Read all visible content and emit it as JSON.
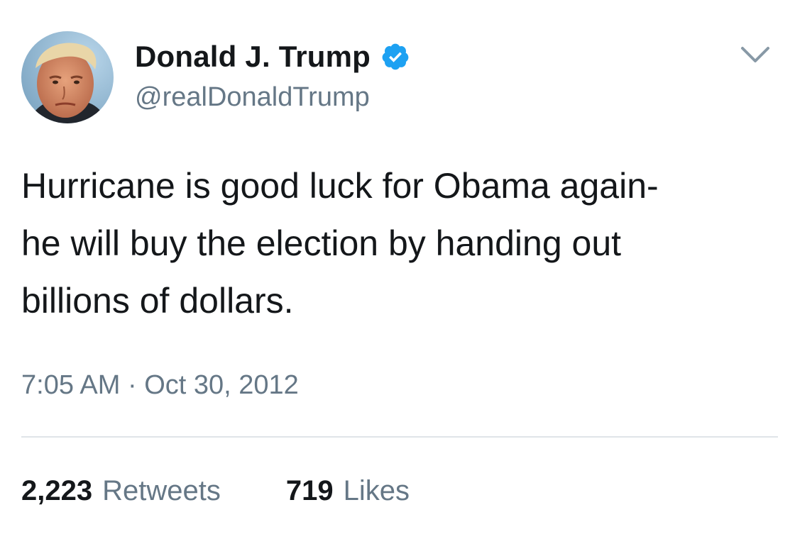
{
  "tweet": {
    "author": {
      "display_name": "Donald J. Trump",
      "handle": "@realDonaldTrump",
      "verified_icon": "verified-badge-icon",
      "avatar_icon": "profile-avatar"
    },
    "text": "Hurricane is good luck for Obama again-\nhe will buy the election by handing out\nbillions of dollars.",
    "timestamp": "7:05 AM · Oct 30, 2012",
    "stats": {
      "retweets_count": "2,223",
      "retweets_label": "Retweets",
      "likes_count": "719",
      "likes_label": "Likes"
    },
    "menu_icon": "chevron-down-icon"
  },
  "colors": {
    "text_primary": "#14171a",
    "text_secondary": "#657786",
    "verified_blue": "#1da1f2",
    "divider": "#dfe4e8"
  }
}
